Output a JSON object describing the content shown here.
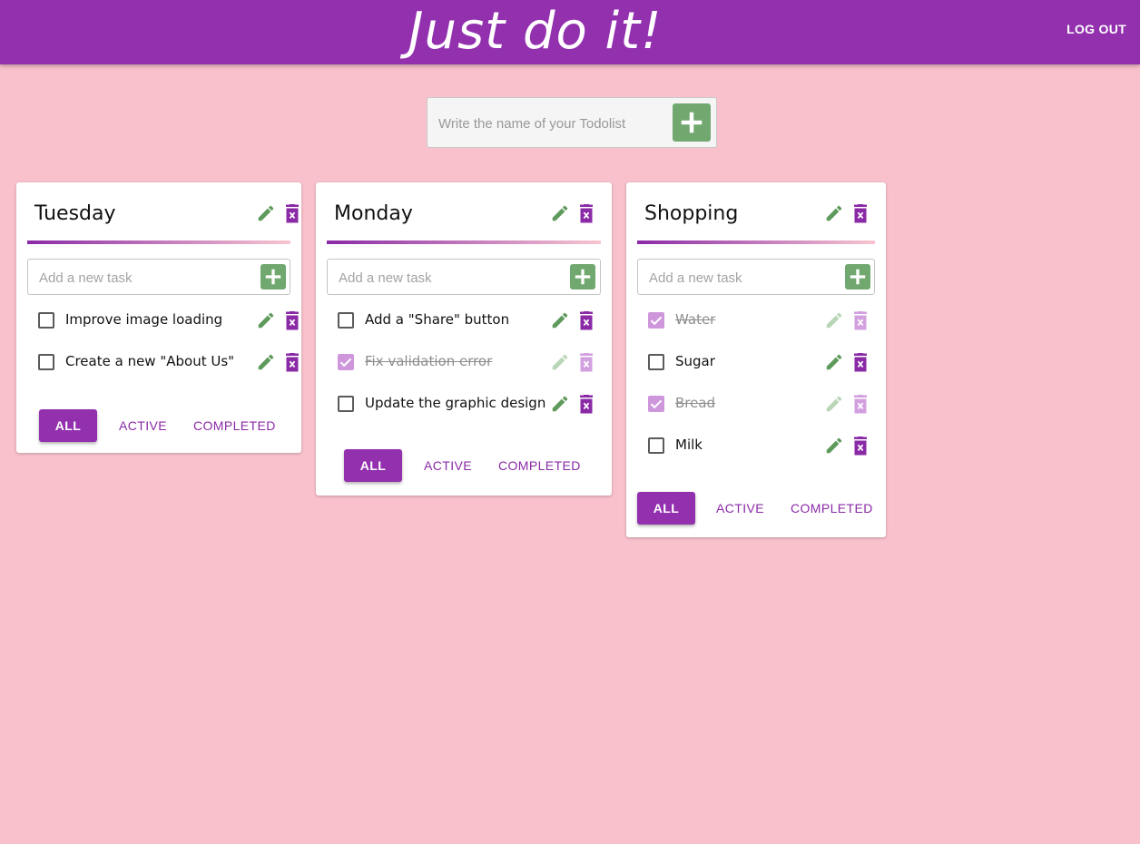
{
  "app": {
    "title": "Just do it!",
    "logout_label": "LOG OUT"
  },
  "new_list": {
    "placeholder": "Write the name of your Todolist",
    "value": ""
  },
  "task_input_placeholder": "Add a new task",
  "filters": [
    "ALL",
    "ACTIVE",
    "COMPLETED"
  ],
  "colors": {
    "appbar": "#9230ae",
    "background": "#f8c1cb",
    "add_button": "#71a86f",
    "edit_icon": "#5e9a5b",
    "delete_icon": "#8a2aa6",
    "checked_box": "#cf97db"
  },
  "lists": [
    {
      "title": "Tuesday",
      "active_filter": "ALL",
      "tasks": [
        {
          "label": "Improve image loading",
          "done": false
        },
        {
          "label": "Create a new \"About Us\"",
          "done": false
        }
      ]
    },
    {
      "title": "Monday",
      "active_filter": "ALL",
      "tasks": [
        {
          "label": "Add a \"Share\" button",
          "done": false
        },
        {
          "label": "Fix validation error",
          "done": true
        },
        {
          "label": "Update the graphic design",
          "done": false
        }
      ]
    },
    {
      "title": "Shopping",
      "active_filter": "ALL",
      "tasks": [
        {
          "label": "Water",
          "done": true
        },
        {
          "label": "Sugar",
          "done": false
        },
        {
          "label": "Bread",
          "done": true
        },
        {
          "label": "Milk",
          "done": false
        }
      ]
    }
  ]
}
